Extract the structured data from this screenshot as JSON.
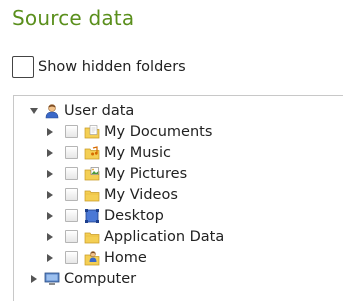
{
  "title": "Source data",
  "show_hidden": {
    "label": "Show hidden folders",
    "checked": false
  },
  "tree": {
    "root": {
      "label": "User data",
      "icon": "user-icon",
      "expanded": true
    },
    "children": [
      {
        "label": "My Documents",
        "icon": "documents-folder-icon"
      },
      {
        "label": "My Music",
        "icon": "music-folder-icon"
      },
      {
        "label": "My Pictures",
        "icon": "pictures-folder-icon"
      },
      {
        "label": "My Videos",
        "icon": "folder-icon"
      },
      {
        "label": "Desktop",
        "icon": "desktop-icon"
      },
      {
        "label": "Application Data",
        "icon": "folder-icon"
      },
      {
        "label": "Home",
        "icon": "home-folder-icon"
      }
    ],
    "computer": {
      "label": "Computer",
      "icon": "computer-icon"
    }
  },
  "colors": {
    "title": "#5a8f1c",
    "folder": "#f4cf54",
    "border": "#c8c8c8"
  }
}
